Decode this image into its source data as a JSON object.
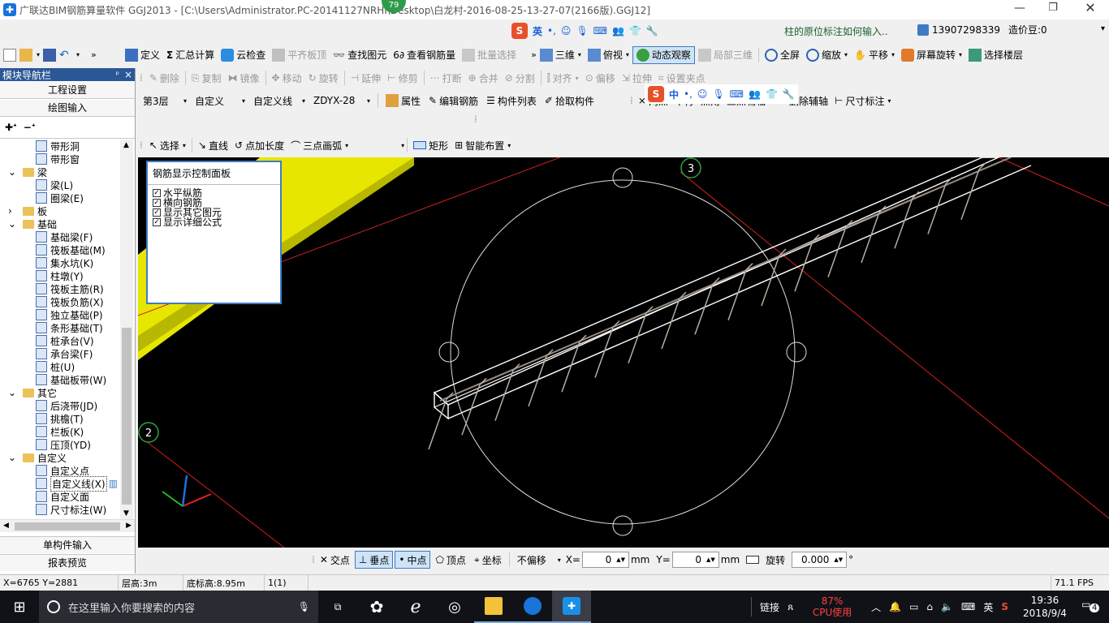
{
  "titlebar": {
    "title": "广联达BIM钢筋算量软件 GGJ2013 - [C:\\Users\\Administrator.PC-20141127NRHI\\Desktop\\白龙村-2016-08-25-13-27-07(2166版).GGJ12]",
    "badge": "79"
  },
  "ime1": {
    "brand": "S",
    "lang": "英"
  },
  "ime2": {
    "brand": "S",
    "lang": "中"
  },
  "hint": {
    "question": "柱的原位标注如何输入..",
    "phone": "13907298339",
    "beans": "造价豆:0"
  },
  "toolbar1": {
    "items": [
      "定义",
      "汇总计算",
      "云检查",
      "平齐板顶",
      "查找图元",
      "查看钢筋量",
      "批量选择",
      "三维",
      "俯视",
      "动态观察",
      "局部三维",
      "全屏",
      "缩放",
      "平移",
      "屏幕旋转",
      "选择楼层"
    ]
  },
  "toolbar2": {
    "items": [
      "删除",
      "复制",
      "镜像",
      "移动",
      "旋转",
      "延伸",
      "修剪",
      "打断",
      "合并",
      "分割",
      "对齐",
      "偏移",
      "拉伸",
      "设置夹点"
    ]
  },
  "toolbar3": {
    "floor": "第3层",
    "category": "自定义",
    "type": "自定义线",
    "element": "ZDYX-28",
    "items": [
      "属性",
      "编辑钢筋",
      "构件列表",
      "拾取构件"
    ]
  },
  "toolbar3b": {
    "items": [
      "两点",
      "平行",
      "点角",
      "三点辅轴",
      "删除辅轴",
      "尺寸标注"
    ]
  },
  "toolbar4": {
    "items": [
      "选择",
      "直线",
      "点加长度",
      "三点画弧",
      "矩形",
      "智能布置"
    ]
  },
  "nav": {
    "title": "模块导航栏",
    "pin": "ᵖ",
    "close": "×",
    "sections": [
      "工程设置",
      "绘图输入"
    ],
    "bottom": [
      "单构件输入",
      "报表预览"
    ],
    "tree": [
      {
        "label": "带形洞",
        "level": 2
      },
      {
        "label": "带形窗",
        "level": 2
      },
      {
        "label": "梁",
        "level": 1,
        "open": true
      },
      {
        "label": "梁(L)",
        "level": 2
      },
      {
        "label": "圈梁(E)",
        "level": 2
      },
      {
        "label": "板",
        "level": 1,
        "open": false
      },
      {
        "label": "基础",
        "level": 1,
        "open": true
      },
      {
        "label": "基础梁(F)",
        "level": 2
      },
      {
        "label": "筏板基础(M)",
        "level": 2
      },
      {
        "label": "集水坑(K)",
        "level": 2
      },
      {
        "label": "柱墩(Y)",
        "level": 2
      },
      {
        "label": "筏板主筋(R)",
        "level": 2
      },
      {
        "label": "筏板负筋(X)",
        "level": 2
      },
      {
        "label": "独立基础(P)",
        "level": 2
      },
      {
        "label": "条形基础(T)",
        "level": 2
      },
      {
        "label": "桩承台(V)",
        "level": 2
      },
      {
        "label": "承台梁(F)",
        "level": 2
      },
      {
        "label": "桩(U)",
        "level": 2
      },
      {
        "label": "基础板带(W)",
        "level": 2
      },
      {
        "label": "其它",
        "level": 1,
        "open": true
      },
      {
        "label": "后浇带(JD)",
        "level": 2
      },
      {
        "label": "挑檐(T)",
        "level": 2
      },
      {
        "label": "栏板(K)",
        "level": 2
      },
      {
        "label": "压顶(YD)",
        "level": 2
      },
      {
        "label": "自定义",
        "level": 1,
        "open": true
      },
      {
        "label": "自定义点",
        "level": 2
      },
      {
        "label": "自定义线(X)",
        "level": 2,
        "selected": true
      },
      {
        "label": "自定义面",
        "level": 2
      },
      {
        "label": "尺寸标注(W)",
        "level": 2
      }
    ]
  },
  "rebarPanel": {
    "title": "钢筋显示控制面板",
    "options": [
      "水平纵筋",
      "横向钢筋",
      "显示其它图元",
      "显示详细公式"
    ]
  },
  "viewport": {
    "axis_labels": [
      "3",
      "2"
    ]
  },
  "snapbar": {
    "items": [
      "交点",
      "垂点",
      "中点",
      "顶点",
      "坐标"
    ],
    "offset": "不偏移",
    "x_label": "X=",
    "x_value": "0",
    "mm1": "mm",
    "y_label": "Y=",
    "y_value": "0",
    "mm2": "mm",
    "rotate_label": "旋转",
    "rotate_value": "0.000",
    "deg": "°"
  },
  "status": {
    "coords": "X=6765 Y=2881",
    "floor_height": "层高:3m",
    "bottom_height": "底标高:8.95m",
    "count": "1(1)",
    "fps": "71.1 FPS"
  },
  "taskbar": {
    "search": "在这里输入你要搜索的内容",
    "link": "链接",
    "cpu_pct": "87%",
    "cpu_label": "CPU使用",
    "lang": "英",
    "time": "19:36",
    "date": "2018/9/4",
    "notif": "4"
  },
  "colors": {
    "accent": "#3f7bc2",
    "viewport_bg": "#000000",
    "slab": "#e6e600",
    "axis_red": "#d42020"
  }
}
